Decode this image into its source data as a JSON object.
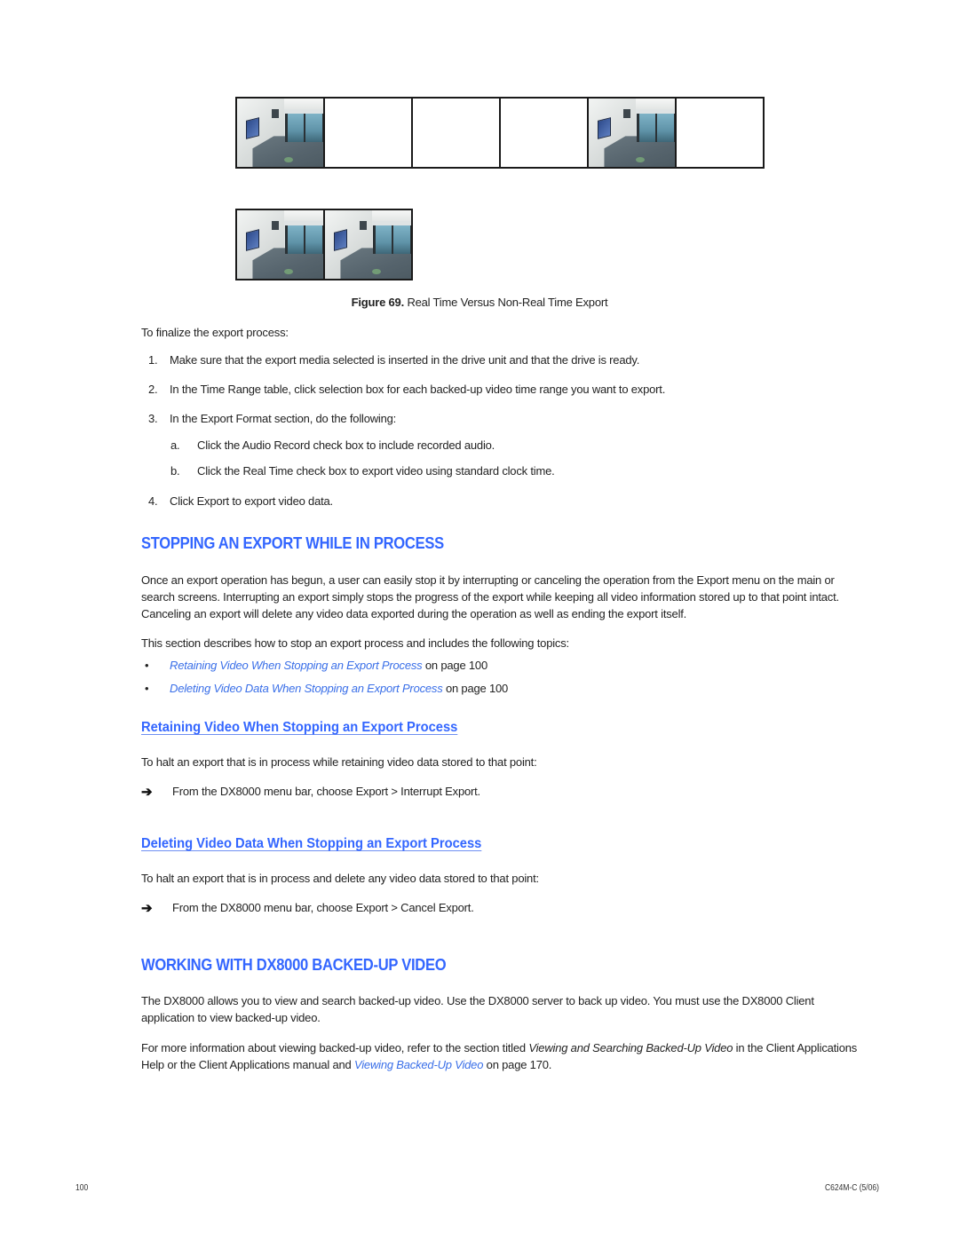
{
  "figure": {
    "strip_top": {
      "frames": [
        {
          "type": "video",
          "label": "camera-frame"
        },
        {
          "type": "blank",
          "label": "empty-frame"
        },
        {
          "type": "blank",
          "label": "empty-frame"
        },
        {
          "type": "blank",
          "label": "empty-frame"
        },
        {
          "type": "video",
          "label": "camera-frame"
        },
        {
          "type": "blank",
          "label": "empty-frame"
        }
      ]
    },
    "strip_bottom": {
      "frames": [
        {
          "type": "video",
          "label": "camera-frame"
        },
        {
          "type": "video",
          "label": "camera-frame"
        }
      ]
    },
    "caption_label": "Figure 69.",
    "caption_text": "Real Time Versus Non-Real Time Export"
  },
  "finalize": {
    "intro": "To finalize the export process:",
    "steps": [
      {
        "num": "1.",
        "text": "Make sure that the export media selected is inserted in the drive unit and that the drive is ready."
      },
      {
        "num": "2.",
        "text": "In the Time Range table, click selection box for each backed-up video time range you want to export."
      },
      {
        "num": "3.",
        "text": "In the Export Format section, do the following:"
      },
      {
        "num": "4.",
        "text": "Click Export to export video data."
      }
    ],
    "substeps": [
      {
        "num": "a.",
        "text": "Click the Audio Record check box to include recorded audio."
      },
      {
        "num": "b.",
        "text": "Click the Real Time check box to export video using standard clock time."
      }
    ]
  },
  "stopping": {
    "heading": "STOPPING AN EXPORT WHILE IN PROCESS",
    "paragraph": "Once an export operation has begun, a user can easily stop it by interrupting or canceling the operation from the Export menu on the main or search screens. Interrupting an export simply stops the progress of the export while keeping all video information stored up to that point intact. Canceling an export will delete any video data exported during the operation as well as ending the export itself.",
    "topics_intro": "This section describes how to stop an export process and includes the following topics:",
    "topics": [
      {
        "link": "Retaining Video When Stopping an Export Process",
        "suffix": " on page 100"
      },
      {
        "link": "Deleting Video Data When Stopping an Export Process",
        "suffix": " on page 100"
      }
    ]
  },
  "retaining": {
    "heading": "Retaining Video When Stopping an Export Process",
    "intro": "To halt an export that is in process while retaining video data stored to that point:",
    "step": "From the DX8000 menu bar, choose Export > Interrupt Export."
  },
  "deleting": {
    "heading": "Deleting Video Data When Stopping an Export Process",
    "intro": "To halt an export that is in process and delete any video data stored to that point:",
    "step": "From the DX8000 menu bar, choose Export > Cancel Export."
  },
  "working": {
    "heading": "WORKING WITH DX8000 BACKED-UP VIDEO",
    "para1": "The DX8000 allows you to view and search backed-up video. Use the DX8000 server to back up video. You must use the DX8000 Client application to view backed-up video.",
    "para2_before": "For more information about viewing backed-up video, refer to the section titled ",
    "para2_italic": "Viewing and Searching Backed-Up Video",
    "para2_middle": " in the Client Applications Help or the Client Applications manual and ",
    "para2_link": "Viewing Backed-Up Video",
    "para2_after": " on page 170."
  },
  "footer": {
    "page_number": "100",
    "doc_code": "C624M-C (5/06)"
  },
  "colors": {
    "heading_blue": "#3366ff",
    "link_blue": "#3a6fe8"
  },
  "icons": {
    "step_arrow": "arrow-right-icon",
    "bullet": "bullet-icon"
  }
}
